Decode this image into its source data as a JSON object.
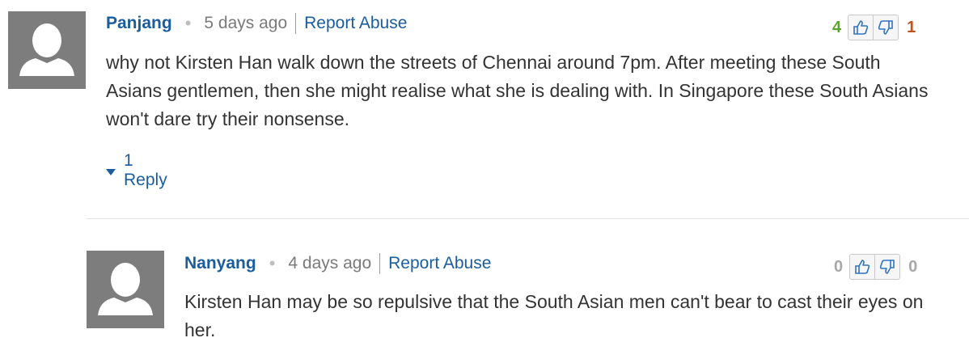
{
  "comments": [
    {
      "author": "Panjang",
      "time": "5 days ago",
      "report_label": "Report Abuse",
      "text": "why not Kirsten Han walk down the streets of Chennai around 7pm. After meeting these South Asians gentlemen, then she might realise what she is dealing with. In Singapore these South Asians won't dare try their nonsense.",
      "likes": "4",
      "dislikes": "1",
      "reply_label": "1 Reply"
    },
    {
      "author": "Nanyang",
      "time": "4 days ago",
      "report_label": "Report Abuse",
      "text": "Kirsten Han may be so repulsive that the South Asian men can't bear to cast their eyes on her.",
      "likes": "0",
      "dislikes": "0"
    }
  ],
  "icons": {
    "separator": "•",
    "avatar": "default-avatar-icon",
    "thumb_up": "thumbs-up-icon",
    "thumb_down": "thumbs-down-icon",
    "expand": "caret-down-icon"
  },
  "colors": {
    "link": "#1a5d9e",
    "positive": "#5aa52a",
    "negative": "#c0521c",
    "avatar_bg": "#7d7d7d"
  }
}
